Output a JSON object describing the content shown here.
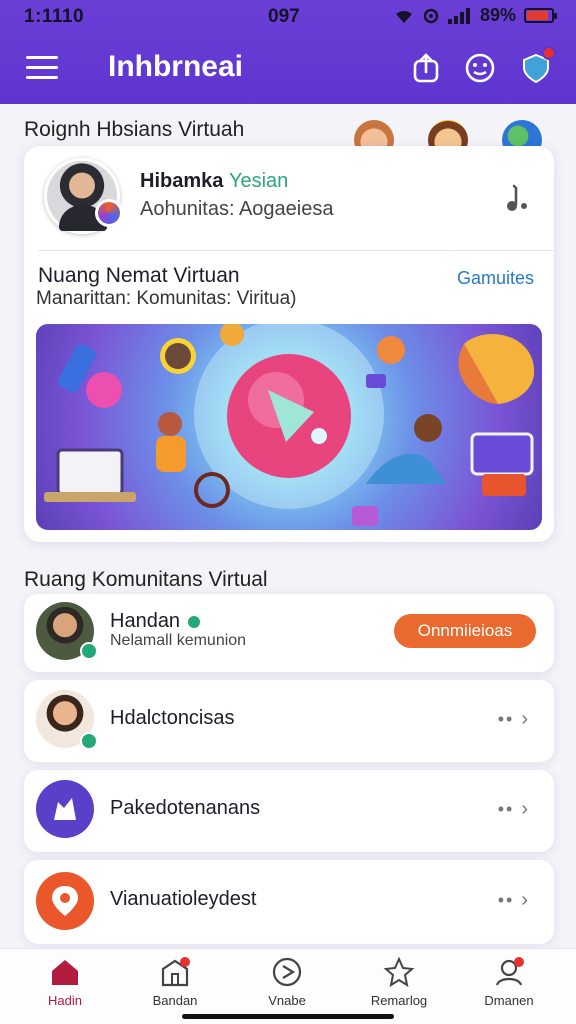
{
  "status_bar": {
    "time": "1:1110",
    "center": "097",
    "battery": "89%",
    "battery_level": 0.89
  },
  "header": {
    "title": "Inhbrneai",
    "icons": [
      "share-icon",
      "smile-icon",
      "notification-shield-icon"
    ]
  },
  "featured": {
    "section_title": "Roignh Hbsians Virtuah",
    "profile": {
      "name": "Hibamka",
      "name_highlight": "Yesian",
      "subtitle": "Aohunitas: Aogaeiesa"
    },
    "room_title": "Nuang Nemat Virtuan",
    "room_subtitle": "Manarittan: Komunitas: Viritua)",
    "room_link": "Gamuites"
  },
  "community": {
    "section_title": "Ruang Komunitans Virtual",
    "items": [
      {
        "title": "Handan",
        "subtitle": "Nelamall kemunion",
        "action": "Onnmiieioas"
      },
      {
        "title": "Hdalctoncisas"
      },
      {
        "title": "Pakedotenanans"
      },
      {
        "title": "Vianuatioleydest"
      }
    ]
  },
  "bottom_nav": [
    {
      "label": "Hadin",
      "icon": "home-icon"
    },
    {
      "label": "Bandan",
      "icon": "building-icon"
    },
    {
      "label": "Vnabe",
      "icon": "play-circle-icon"
    },
    {
      "label": "Remarlog",
      "icon": "star-badge-icon"
    },
    {
      "label": "Dmanen",
      "icon": "profile-icon"
    }
  ],
  "colors": {
    "header": "#5e35cf",
    "accent_orange": "#e9692f",
    "link": "#2a78c8",
    "active_nav": "#b01b3e"
  }
}
